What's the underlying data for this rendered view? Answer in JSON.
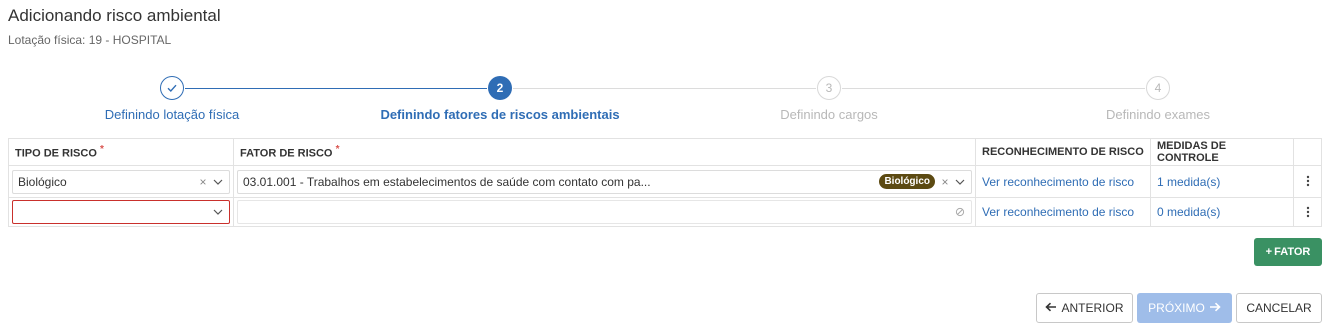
{
  "header": {
    "title": "Adicionando risco ambiental",
    "subtitle": "Lotação física: 19 - HOSPITAL"
  },
  "stepper": {
    "steps": [
      {
        "number": "",
        "label": "Definindo lotação física",
        "state": "done"
      },
      {
        "number": "2",
        "label": "Definindo fatores de riscos ambientais",
        "state": "active"
      },
      {
        "number": "3",
        "label": "Definindo cargos",
        "state": "todo"
      },
      {
        "number": "4",
        "label": "Definindo exames",
        "state": "todo"
      }
    ]
  },
  "table": {
    "columns": {
      "tipo": "TIPO DE RISCO",
      "fator": "FATOR DE RISCO",
      "reconhecimento": "RECONHECIMENTO DE RISCO",
      "medidas": "MEDIDAS DE CONTROLE",
      "required_mark": "*"
    },
    "rows": [
      {
        "tipo": "Biológico",
        "fator": "03.01.001 - Trabalhos em estabelecimentos de saúde com contato com pa...",
        "fator_badge": "Biológico",
        "reconhecimento": "Ver reconhecimento de risco",
        "medidas": "1 medida(s)"
      },
      {
        "tipo": "",
        "fator": "",
        "reconhecimento": "Ver reconhecimento de risco",
        "medidas": "0 medida(s)"
      }
    ]
  },
  "buttons": {
    "fator": "FATOR",
    "anterior": "ANTERIOR",
    "proximo": "PRÓXIMO",
    "cancelar": "CANCELAR"
  },
  "colors": {
    "primary": "#2f6db5",
    "success": "#3a9163",
    "badge": "#5c4a12",
    "error": "#c9302c",
    "disabled_primary": "#9fbde9"
  },
  "icons": [
    "check-icon",
    "clear-icon",
    "chevron-down-icon",
    "disabled-icon",
    "kebab-icon",
    "plus-icon",
    "arrow-left-icon",
    "arrow-right-icon"
  ]
}
